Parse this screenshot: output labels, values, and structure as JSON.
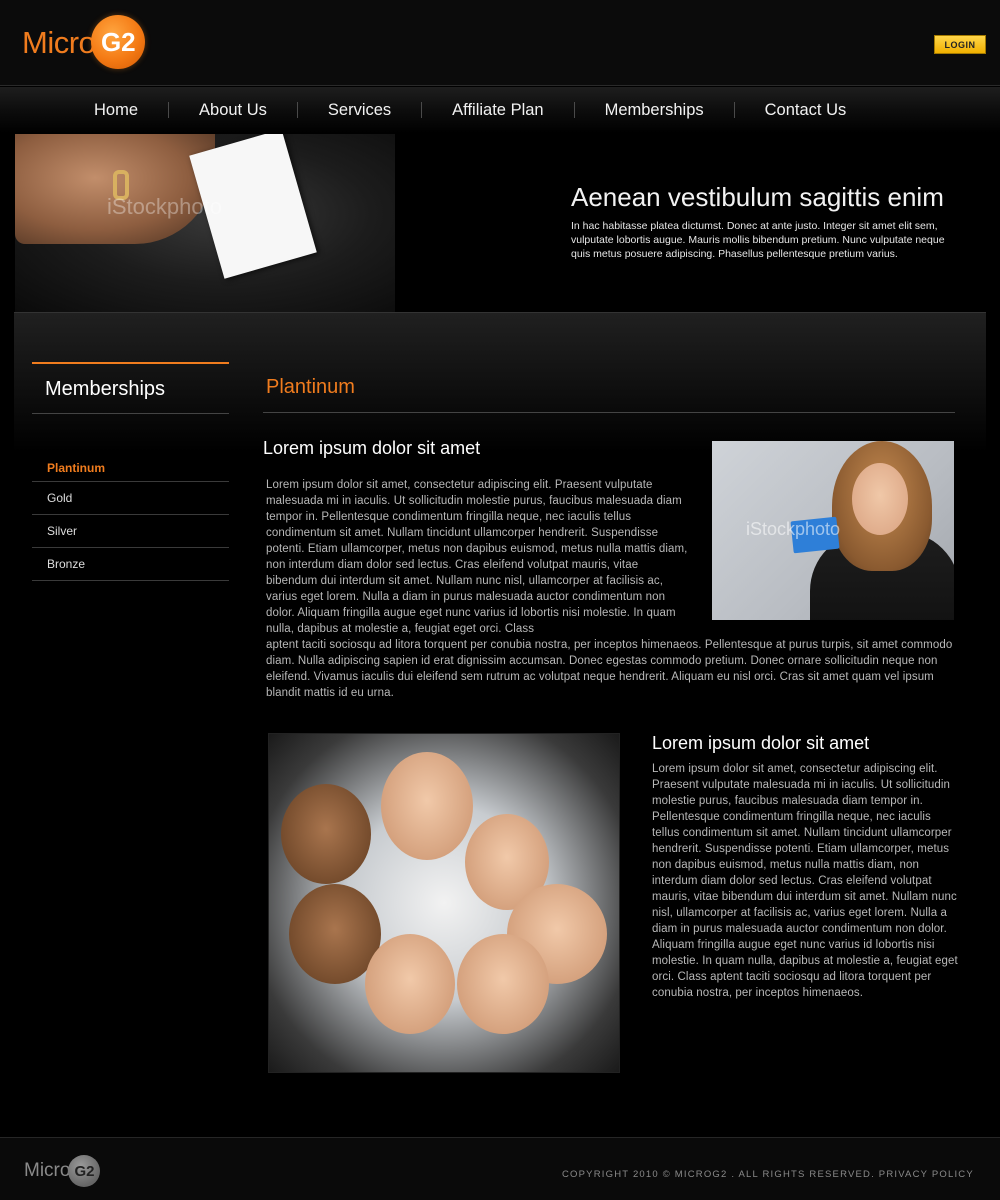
{
  "header": {
    "logo_text": "Micro",
    "logo_badge": "G2",
    "login_label": "LOGIN"
  },
  "nav": {
    "items": [
      {
        "label": "Home"
      },
      {
        "label": "About Us"
      },
      {
        "label": "Services"
      },
      {
        "label": "Affiliate Plan"
      },
      {
        "label": "Memberships"
      },
      {
        "label": "Contact Us"
      }
    ]
  },
  "banner": {
    "watermark": "iStockphoto",
    "title": "Aenean vestibulum sagittis enim",
    "text": "In hac habitasse platea dictumst. Donec at ante justo. Integer sit amet elit sem, vulputate lobortis augue. Mauris mollis bibendum pretium. Nunc vulputate neque quis metus posuere adipiscing. Phasellus pellentesque pretium varius."
  },
  "sidebar": {
    "title": "Memberships",
    "items": [
      {
        "label": "Plantinum",
        "active": true
      },
      {
        "label": "Gold"
      },
      {
        "label": "Silver"
      },
      {
        "label": "Bronze"
      }
    ]
  },
  "content": {
    "title": "Plantinum",
    "section1": {
      "heading": "Lorem ipsum dolor sit amet",
      "text_a": "Lorem ipsum dolor sit amet, consectetur adipiscing elit. Praesent vulputate malesuada mi in iaculis. Ut sollicitudin molestie purus, faucibus malesuada diam tempor in. Pellentesque condimentum fringilla neque, nec iaculis tellus condimentum sit amet. Nullam tincidunt ullamcorper hendrerit. Suspendisse potenti. Etiam ullamcorper, metus non dapibus euismod, metus nulla mattis diam, non interdum diam dolor sed lectus. Cras eleifend volutpat mauris, vitae bibendum dui interdum sit amet. Nullam nunc nisl, ullamcorper at facilisis ac, varius eget lorem. Nulla a diam in purus malesuada auctor condimentum non dolor. Aliquam fringilla augue eget nunc varius id lobortis nisi molestie. In quam nulla, dapibus at molestie a, feugiat eget orci. Class",
      "text_b": "aptent taciti sociosqu ad litora torquent per conubia nostra, per inceptos himenaeos. Pellentesque at purus turpis, sit amet commodo diam. Nulla adipiscing sapien id erat dignissim accumsan. Donec egestas commodo pretium. Donec ornare sollicitudin neque non eleifend. Vivamus iaculis dui eleifend sem rutrum ac volutpat neque hendrerit. Aliquam eu nisl orci. Cras sit amet quam vel ipsum blandit mattis id eu urna.",
      "photo_watermark": "iStockphoto"
    },
    "section2": {
      "heading": "Lorem ipsum dolor sit amet",
      "text": "Lorem ipsum dolor sit amet, consectetur adipiscing elit. Praesent vulputate malesuada mi in iaculis. Ut sollicitudin molestie purus, faucibus malesuada diam tempor in. Pellentesque condimentum fringilla neque, nec iaculis tellus condimentum sit amet. Nullam tincidunt ullamcorper hendrerit. Suspendisse potenti. Etiam ullamcorper, metus non dapibus euismod, metus nulla mattis diam, non interdum diam dolor sed lectus. Cras eleifend volutpat mauris, vitae bibendum dui interdum sit amet. Nullam nunc nisl, ullamcorper at facilisis ac, varius eget lorem. Nulla a diam in purus malesuada auctor condimentum non dolor. Aliquam fringilla augue eget nunc varius id lobortis nisi molestie. In quam nulla, dapibus at molestie a, feugiat eget orci. Class aptent taciti sociosqu ad litora torquent per conubia nostra, per inceptos himenaeos."
    }
  },
  "footer": {
    "logo_text": "Micro",
    "logo_badge": "G2",
    "copyright": "COPYRIGHT 2010 © MICROG2 . ALL RIGHTS RESERVED.",
    "privacy_label": "PRIVACY POLICY"
  },
  "colors": {
    "accent": "#f07c1e",
    "background": "#000000",
    "login_button": "#f1b000"
  }
}
